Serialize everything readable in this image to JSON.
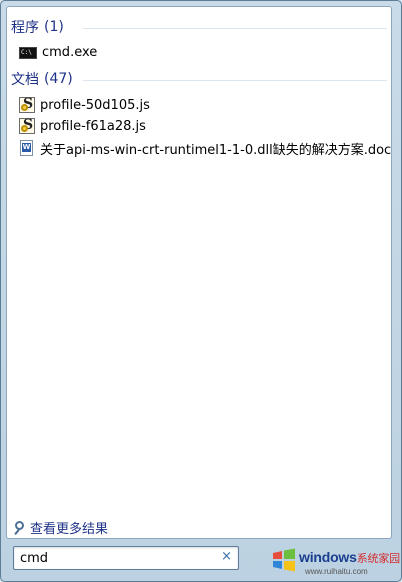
{
  "groups": [
    {
      "title": "程序",
      "count": "(1)",
      "items": [
        {
          "label": "cmd.exe",
          "icon": "cmd-icon"
        }
      ]
    },
    {
      "title": "文档",
      "count": "(47)",
      "items": [
        {
          "label": "profile-50d105.js",
          "icon": "js-script-icon"
        },
        {
          "label": "profile-f61a28.js",
          "icon": "js-script-icon"
        },
        {
          "label": "关于api-ms-win-crt-runtimel1-1-0.dll缺失的解决方案.doc",
          "icon": "word-doc-icon"
        }
      ]
    }
  ],
  "see_more": {
    "label": "查看更多结果",
    "icon": "search-icon"
  },
  "search": {
    "value": "cmd",
    "clear_icon": "close-icon",
    "clear_glyph": "×"
  },
  "watermark": {
    "title": "windows",
    "title_suffix": "系统家园",
    "url": "www.ruihaitu.com"
  },
  "colors": {
    "header_text": "#1e3287",
    "panel_bg": "#ffffff",
    "frame_bg": "#c9dbe8"
  }
}
